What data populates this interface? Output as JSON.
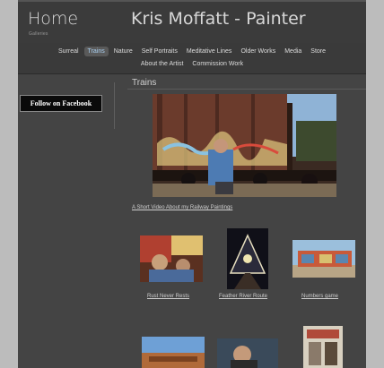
{
  "header": {
    "home_label": "Home",
    "home_sub": "Galleries",
    "site_name": "Kris Moffatt - Painter"
  },
  "nav": {
    "row1": [
      "Surreal",
      "Trains",
      "Nature",
      "Self Portraits",
      "Meditative Lines",
      "Older Works",
      "Media",
      "Store"
    ],
    "row2": [
      "About the Artist",
      "Commission Work"
    ],
    "active": "Trains"
  },
  "sidebar": {
    "facebook_button": "Follow on Facebook"
  },
  "main": {
    "section_title": "Trains",
    "video_link": "A Short Video About my Railway Paintings",
    "gallery": [
      {
        "caption": "Rust Never Rests"
      },
      {
        "caption": "Feather River Route"
      },
      {
        "caption": "Numbers game"
      }
    ]
  },
  "colors": {
    "background": "#444444",
    "link": "#cfcfcf",
    "active_nav": "#a9cff0"
  }
}
